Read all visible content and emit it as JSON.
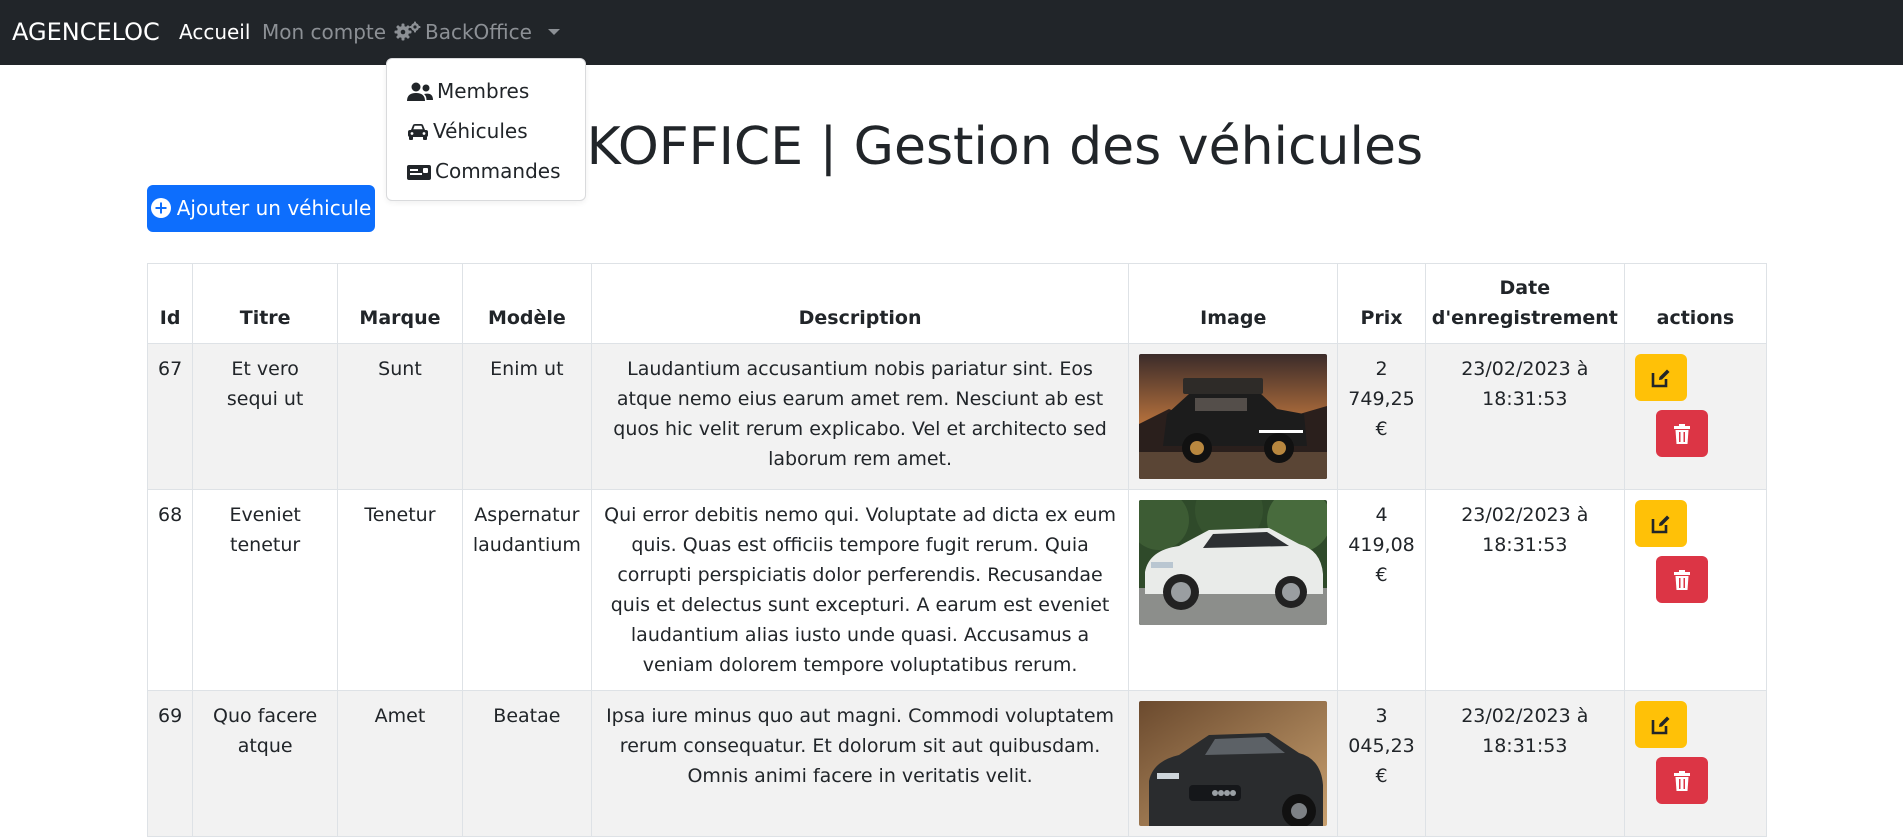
{
  "navbar": {
    "brand": "AGENCELOC",
    "links": [
      "Accueil",
      "Mon compte"
    ],
    "backoffice_label": "BackOffice",
    "dropdown": [
      "Membres",
      "Véhicules",
      "Commandes"
    ]
  },
  "page": {
    "title": "BACKOFFICE | Gestion des véhicules",
    "add_button": "Ajouter un véhicule"
  },
  "table": {
    "headers": [
      "Id",
      "Titre",
      "Marque",
      "Modèle",
      "Description",
      "Image",
      "Prix",
      "Date d'enregistrement",
      "actions"
    ],
    "rows": [
      {
        "id": "67",
        "titre": "Et vero sequi ut",
        "marque": "Sunt",
        "modele": "Enim ut",
        "description": "Laudantium accusantium nobis pariatur sint. Eos atque nemo eius earum amet rem. Nesciunt ab est quos hic velit rerum explicabo. Vel et architecto sed laborum rem amet.",
        "prix": "2 749,25 €",
        "date": "23/02/2023 à 18:31:53"
      },
      {
        "id": "68",
        "titre": "Eveniet tenetur",
        "marque": "Tenetur",
        "modele": "Aspernatur laudantium",
        "description": "Qui error debitis nemo qui. Voluptate ad dicta ex eum quis. Quas est officiis tempore fugit rerum. Quia corrupti perspiciatis dolor perferendis. Recusandae quis et delectus sunt excepturi. A earum est eveniet laudantium alias iusto unde quasi. Accusamus a veniam dolorem tempore voluptatibus rerum.",
        "prix": "4 419,08 €",
        "date": "23/02/2023 à 18:31:53"
      },
      {
        "id": "69",
        "titre": "Quo facere atque",
        "marque": "Amet",
        "modele": "Beatae",
        "description": "Ipsa iure minus quo aut magni. Commodi voluptatem rerum consequatur. Et dolorum sit aut quibusdam. Omnis animi facere in veritatis velit.",
        "prix": "3 045,23 €",
        "date": "23/02/2023 à 18:31:53"
      }
    ]
  },
  "icons": {
    "gear": "gears-icon",
    "members": "users-icon",
    "vehicles": "car-icon",
    "orders": "id-card-icon",
    "add": "plus-circle-icon",
    "edit": "edit-icon",
    "delete": "trash-icon"
  },
  "colors": {
    "navbar": "#212529",
    "primary": "#0d6efd",
    "warning": "#ffc107",
    "danger": "#dc3545",
    "stripe": "#f2f2f2"
  }
}
